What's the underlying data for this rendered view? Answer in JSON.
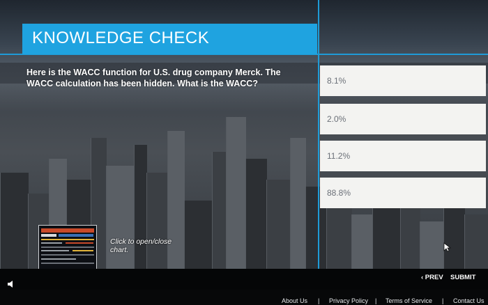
{
  "header": {
    "title": "KNOWLEDGE CHECK"
  },
  "question": {
    "text": "Here is the WACC function for U.S. drug company Merck. The WACC calculation has been hidden. What is the WACC?"
  },
  "options": [
    {
      "label": "8.1%"
    },
    {
      "label": "2.0%"
    },
    {
      "label": "11.2%"
    },
    {
      "label": "88.8%"
    }
  ],
  "chart_toggle": {
    "label": "Click to open/close chart."
  },
  "nav": {
    "prev_label": "‹ PREV",
    "submit_label": "SUBMIT"
  },
  "footer": {
    "links": [
      "About Us",
      "Privacy Policy",
      "Terms of Service",
      "Contact Us"
    ],
    "separator": "|"
  },
  "colors": {
    "accent": "#1fa3e0",
    "option_bg": "#f3f3f1",
    "option_text": "#6b7078"
  }
}
